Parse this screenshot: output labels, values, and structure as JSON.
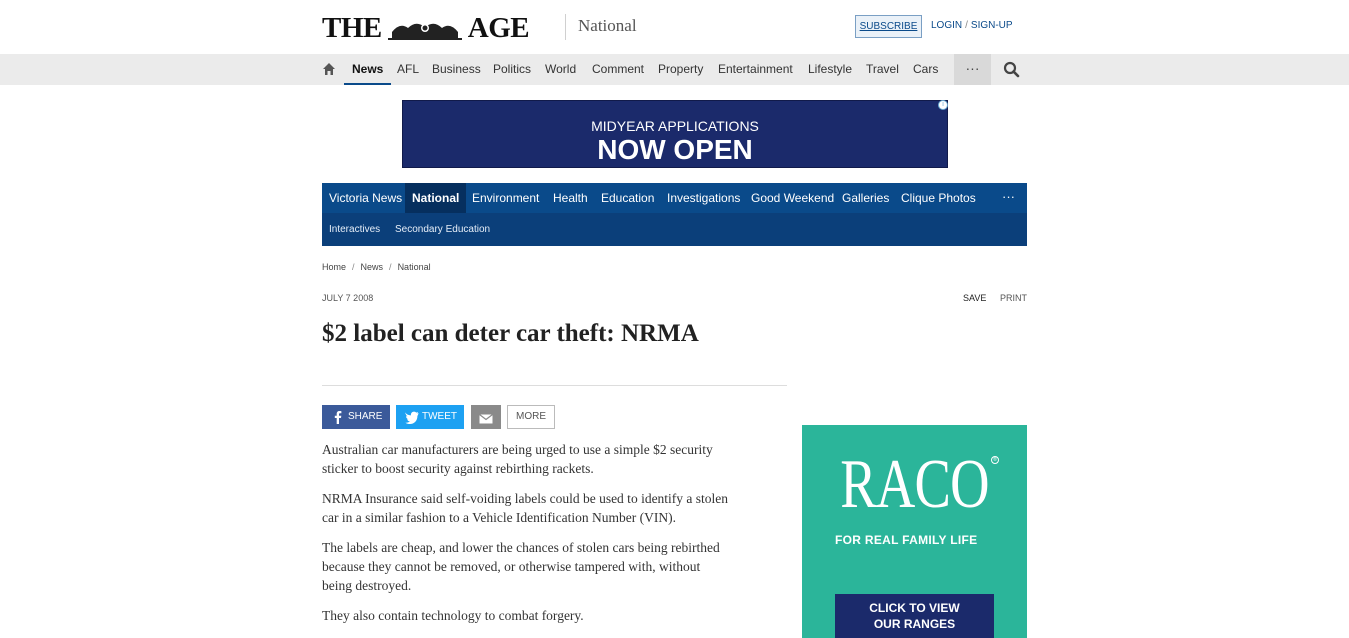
{
  "header": {
    "logo_left": "THE",
    "logo_right": "AGE",
    "section": "National",
    "subscribe": "SUBSCRIBE",
    "login": "LOGIN",
    "login_sep": "/",
    "signup": "SIGN-UP"
  },
  "main_nav": {
    "items": [
      "News",
      "AFL",
      "Business",
      "Politics",
      "World",
      "Comment",
      "Property",
      "Entertainment",
      "Lifestyle",
      "Travel",
      "Cars"
    ],
    "active": "News",
    "more": "···"
  },
  "ad_banner": {
    "line1": "MIDYEAR APPLICATIONS",
    "line2": "NOW OPEN"
  },
  "section_nav": {
    "row1": [
      "Victoria News",
      "National",
      "Environment",
      "Health",
      "Education",
      "Investigations",
      "Good Weekend",
      "Galleries",
      "Clique Photos"
    ],
    "row2": [
      "Interactives",
      "Secondary Education"
    ],
    "active": "National",
    "more": "···"
  },
  "breadcrumb": [
    "Home",
    "News",
    "National"
  ],
  "breadcrumb_sep": "/",
  "article": {
    "date": "JULY 7 2008",
    "save": "SAVE",
    "print": "PRINT",
    "headline": "$2 label can deter car theft: NRMA",
    "paragraphs": [
      "Australian car manufacturers are being urged to use a simple $2 security sticker to boost security against rebirthing rackets.",
      "NRMA Insurance said self-voiding labels could be used to identify a stolen car in a similar fashion to a Vehicle Identification Number (VIN).",
      "The labels are cheap, and lower the chances of stolen cars being rebirthed because they cannot be removed, or otherwise tampered with, without being destroyed.",
      "They also contain technology to combat forgery."
    ]
  },
  "share": {
    "facebook": "SHARE",
    "twitter": "TWEET",
    "more": "MORE"
  },
  "side_ad": {
    "brand": "RACO",
    "reg": "®",
    "tagline": "FOR REAL FAMILY LIFE",
    "cta_line1": "CLICK TO VIEW",
    "cta_line2": "OUR RANGES"
  },
  "adchoice": "i",
  "colors": {
    "brand_blue": "#0a4a8a",
    "ad_navy": "#1b2a6b",
    "ad_teal": "#2bb59a",
    "facebook": "#3b5a9a",
    "twitter": "#1da1f2"
  }
}
